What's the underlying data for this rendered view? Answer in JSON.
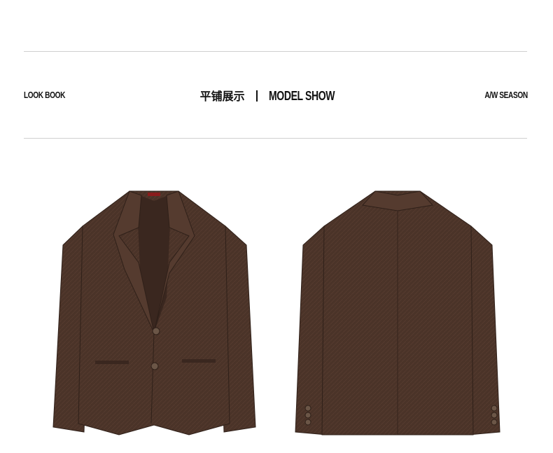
{
  "header": {
    "left_label": "LOOK BOOK",
    "center_cn": "平铺展示",
    "center_en": "MODEL SHOW",
    "right_label": "A/W SEASON"
  },
  "colors": {
    "jacket": "#4a3328",
    "jacket_shadow": "#3a271f",
    "rule": "#cfcfcf"
  }
}
